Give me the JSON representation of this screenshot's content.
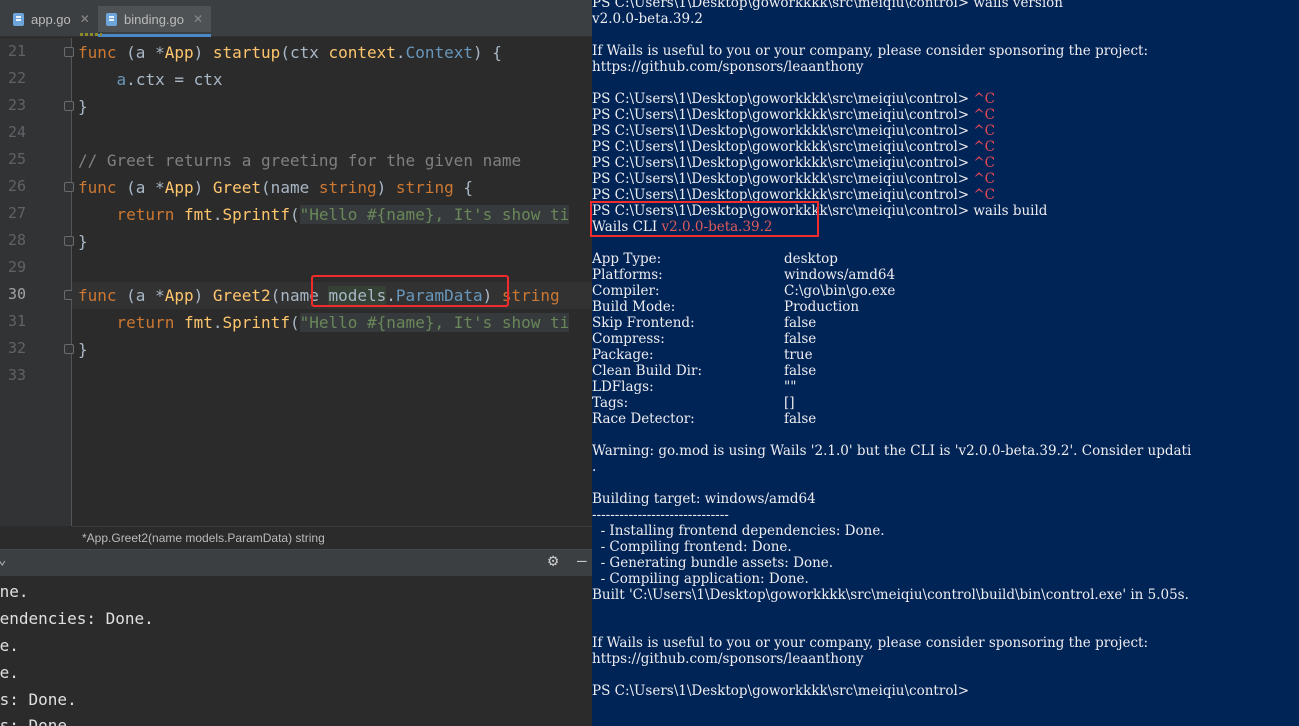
{
  "ide": {
    "tabs": [
      {
        "label": "app.go",
        "close": "✕"
      },
      {
        "label": "binding.go",
        "close": "✕"
      }
    ],
    "line_numbers": [
      "21",
      "22",
      "23",
      "24",
      "25",
      "26",
      "27",
      "28",
      "29",
      "30",
      "31",
      "32",
      "33"
    ],
    "current_line": "30",
    "status_hint": "*App.Greet2(name models.ParamData) string",
    "code": {
      "l21": {
        "kw": "func",
        "a": " (a *",
        "type": "App",
        "b": ") ",
        "fn": "startup",
        "c": "(ctx ",
        "pkg": "context",
        "dot": ".",
        "iface": "Context",
        "d": ") {"
      },
      "l22": {
        "indent": "    ",
        "recv": "a",
        "dot": ".",
        "field": "ctx",
        "rest": " = ctx"
      },
      "l23": {
        "text": "}"
      },
      "l25": {
        "comment": "// Greet returns a greeting for the given name"
      },
      "l26": {
        "kw": "func",
        "a": " (a *",
        "type": "App",
        "b": ") ",
        "fn": "Greet",
        "c": "(name ",
        "ptype": "string",
        "d": ") ",
        "rtype": "string",
        "e": " {"
      },
      "l27": {
        "indent": "    ",
        "kw": "return",
        "sp": " ",
        "pkg": "fmt",
        "dot": ".",
        "fn": "Sprintf",
        "paren": "(",
        "str": "\"Hello #{name}, It's show ti"
      },
      "l28": {
        "text": "}"
      },
      "l30": {
        "kw": "func",
        "a": " (a *",
        "type": "App",
        "b": ") ",
        "fn": "Greet2",
        "c": "(name ",
        "pkg": "models",
        "dot": ".",
        "ptype": "ParamData",
        "d": ") ",
        "rtype": "string"
      },
      "l31": {
        "indent": "    ",
        "kw": "return",
        "sp": " ",
        "pkg": "fmt",
        "dot": ".",
        "fn": "Sprintf",
        "paren": "(",
        "str": "\"Hello #{name}, It's show ti"
      },
      "l32": {
        "text": "}"
      }
    },
    "run_output": [
      "one.",
      "pendencies: Done.",
      "ne.",
      "ne.",
      "ts: Done.",
      "ts: Done."
    ],
    "icons": {
      "gear": "⚙",
      "minimize": "—",
      "caret": "⌄"
    }
  },
  "terminal": {
    "prompt": "PS C:\\Users\\1\\Desktop\\goworkkkk\\src\\meiqiu\\control> ",
    "lines": {
      "t00": "PS C:\\Users\\1\\Desktop\\goworkkkk\\src\\meiqiu\\control> wails version",
      "t01": "v2.0.0-beta.39.2",
      "t03": "If Wails is useful to you or your company, please consider sponsoring the project:",
      "t04": "https://github.com/sponsors/leaanthony",
      "ctrl_c": "^C",
      "build_cmd": "wails build",
      "cli_label": "Wails CLI ",
      "cli_version": "v2.0.0-beta.39.2",
      "app_type_k": "App Type:",
      "app_type_v": "desktop",
      "platforms_k": "Platforms:",
      "platforms_v": "windows/amd64",
      "compiler_k": "Compiler:",
      "compiler_v": "C:\\go\\bin\\go.exe",
      "build_mode_k": "Build Mode:",
      "build_mode_v": "Production",
      "skip_frontend_k": "Skip Frontend:",
      "skip_frontend_v": "false",
      "compress_k": "Compress:",
      "compress_v": "false",
      "package_k": "Package:",
      "package_v": "true",
      "clean_k": "Clean Build Dir:",
      "clean_v": "false",
      "ldflags_k": "LDFlags:",
      "ldflags_v": "\"\"",
      "tags_k": "Tags:",
      "tags_v": "[]",
      "race_k": "Race Detector:",
      "race_v": "false",
      "warning": "Warning: go.mod is using Wails '2.1.0' but the CLI is 'v2.0.0-beta.39.2'. Consider updati",
      "warning_cont": ".",
      "building": "Building target: windows/amd64",
      "dashes": "------------------------------",
      "step1": "  - Installing frontend dependencies: Done.",
      "step2": "  - Compiling frontend: Done.",
      "step3": "  - Generating bundle assets: Done.",
      "step4": "  - Compiling application: Done.",
      "built": "Built 'C:\\Users\\1\\Desktop\\goworkkkk\\src\\meiqiu\\control\\build\\bin\\control.exe' in 5.05s.",
      "sponsor": "If Wails is useful to you or your company, please consider sponsoring the project:",
      "sponsor_url": "https://github.com/sponsors/leaanthony",
      "final_prompt": "PS C:\\Users\\1\\Desktop\\goworkkkk\\src\\meiqiu\\control>"
    }
  },
  "colors": {
    "terminal_bg": "#012456",
    "ide_bg": "#2b2b2b",
    "highlight_box": "#ef2b2b"
  }
}
